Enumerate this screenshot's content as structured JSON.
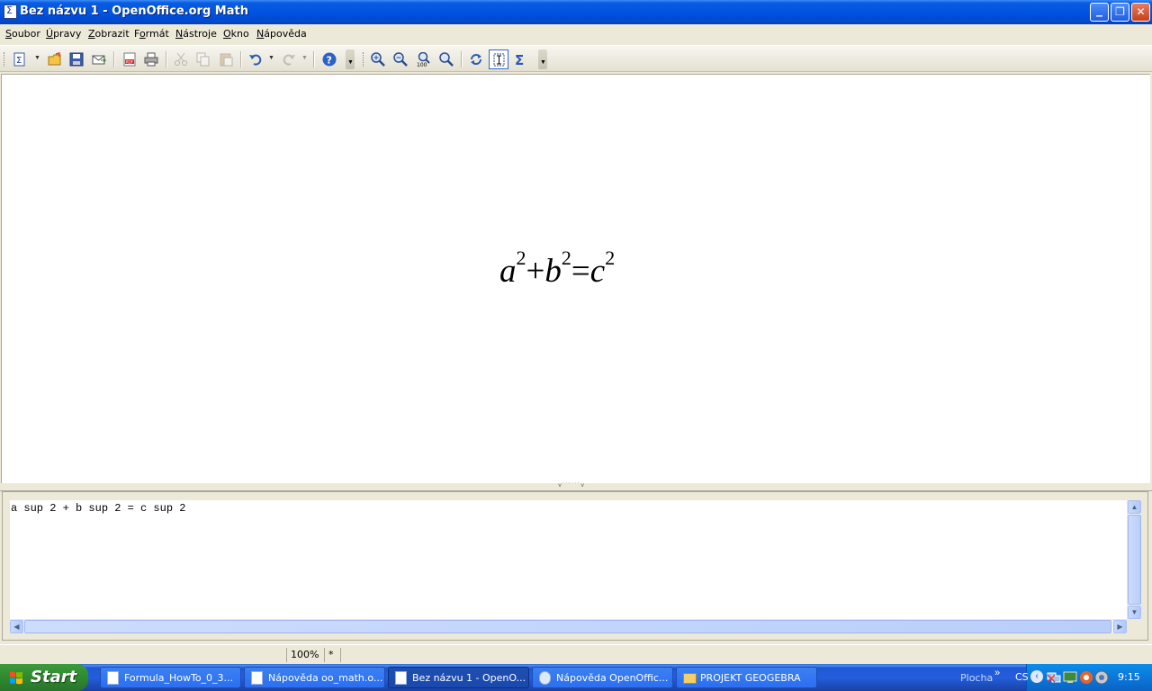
{
  "window": {
    "title": "Bez názvu 1 - OpenOffice.org Math",
    "controls": {
      "minimize": "_",
      "restore": "❐",
      "close": "✕"
    }
  },
  "menubar": {
    "items": [
      {
        "label": "Soubor",
        "accel": "S",
        "rest": "oubor"
      },
      {
        "label": "Úpravy",
        "accel": "Ú",
        "rest": "pravy"
      },
      {
        "label": "Zobrazit",
        "accel": "Z",
        "rest": "obrazit"
      },
      {
        "label": "Formát",
        "accel": "o",
        "pre": "F",
        "rest": "rmát"
      },
      {
        "label": "Nástroje",
        "accel": "N",
        "rest": "ástroje"
      },
      {
        "label": "Okno",
        "accel": "O",
        "rest": "kno"
      },
      {
        "label": "Nápověda",
        "accel": "N",
        "rest": "ápověda"
      }
    ]
  },
  "toolbar": {
    "buttons": [
      "new-document",
      "open",
      "save",
      "email",
      "export-pdf",
      "print",
      "cut",
      "copy",
      "paste",
      "undo",
      "redo",
      "help",
      "zoom-in",
      "zoom-out",
      "zoom-100",
      "show-all",
      "update",
      "formula-cursor",
      "symbols"
    ],
    "colors": {
      "accent": "#316ac5"
    }
  },
  "formula": {
    "a": "a",
    "b": "b",
    "c": "c",
    "exp": "2",
    "plus": "+",
    "equals": "="
  },
  "command": {
    "text": "a sup 2 + b sup 2 = c sup 2"
  },
  "statusbar": {
    "zoom": "100%",
    "modified": "*"
  },
  "taskbar": {
    "start_label": "Start",
    "tasks": [
      {
        "label": "Formula_HowTo_0_3...",
        "active": false
      },
      {
        "label": "Nápověda oo_math.o...",
        "active": false
      },
      {
        "label": "Bez názvu 1 - OpenO...",
        "active": true
      },
      {
        "label": "Nápověda OpenOffic...",
        "active": false
      },
      {
        "label": "PROJEKT GEOGEBRA",
        "active": false
      }
    ],
    "desktop_toolbar": "Plocha",
    "language": "CS",
    "clock": "9:15"
  }
}
